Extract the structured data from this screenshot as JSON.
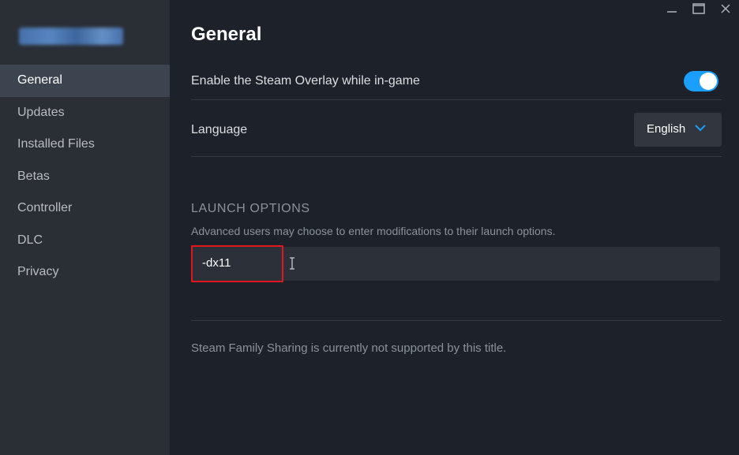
{
  "window": {
    "minimize_icon": "minimize-icon",
    "maximize_icon": "maximize-icon",
    "close_icon": "close-icon"
  },
  "sidebar": {
    "items": [
      {
        "label": "General",
        "active": true
      },
      {
        "label": "Updates",
        "active": false
      },
      {
        "label": "Installed Files",
        "active": false
      },
      {
        "label": "Betas",
        "active": false
      },
      {
        "label": "Controller",
        "active": false
      },
      {
        "label": "DLC",
        "active": false
      },
      {
        "label": "Privacy",
        "active": false
      }
    ]
  },
  "main": {
    "title": "General",
    "overlay": {
      "label": "Enable the Steam Overlay while in-game",
      "enabled": true
    },
    "language": {
      "label": "Language",
      "value": "English"
    },
    "launch_options": {
      "title": "LAUNCH OPTIONS",
      "description": "Advanced users may choose to enter modifications to their launch options.",
      "value": "-dx11"
    },
    "family_sharing_note": "Steam Family Sharing is currently not supported by this title."
  },
  "colors": {
    "accent": "#1a9fff",
    "highlight": "#e0171f",
    "background": "#1d212a",
    "sidebar": "#2a2e35"
  }
}
